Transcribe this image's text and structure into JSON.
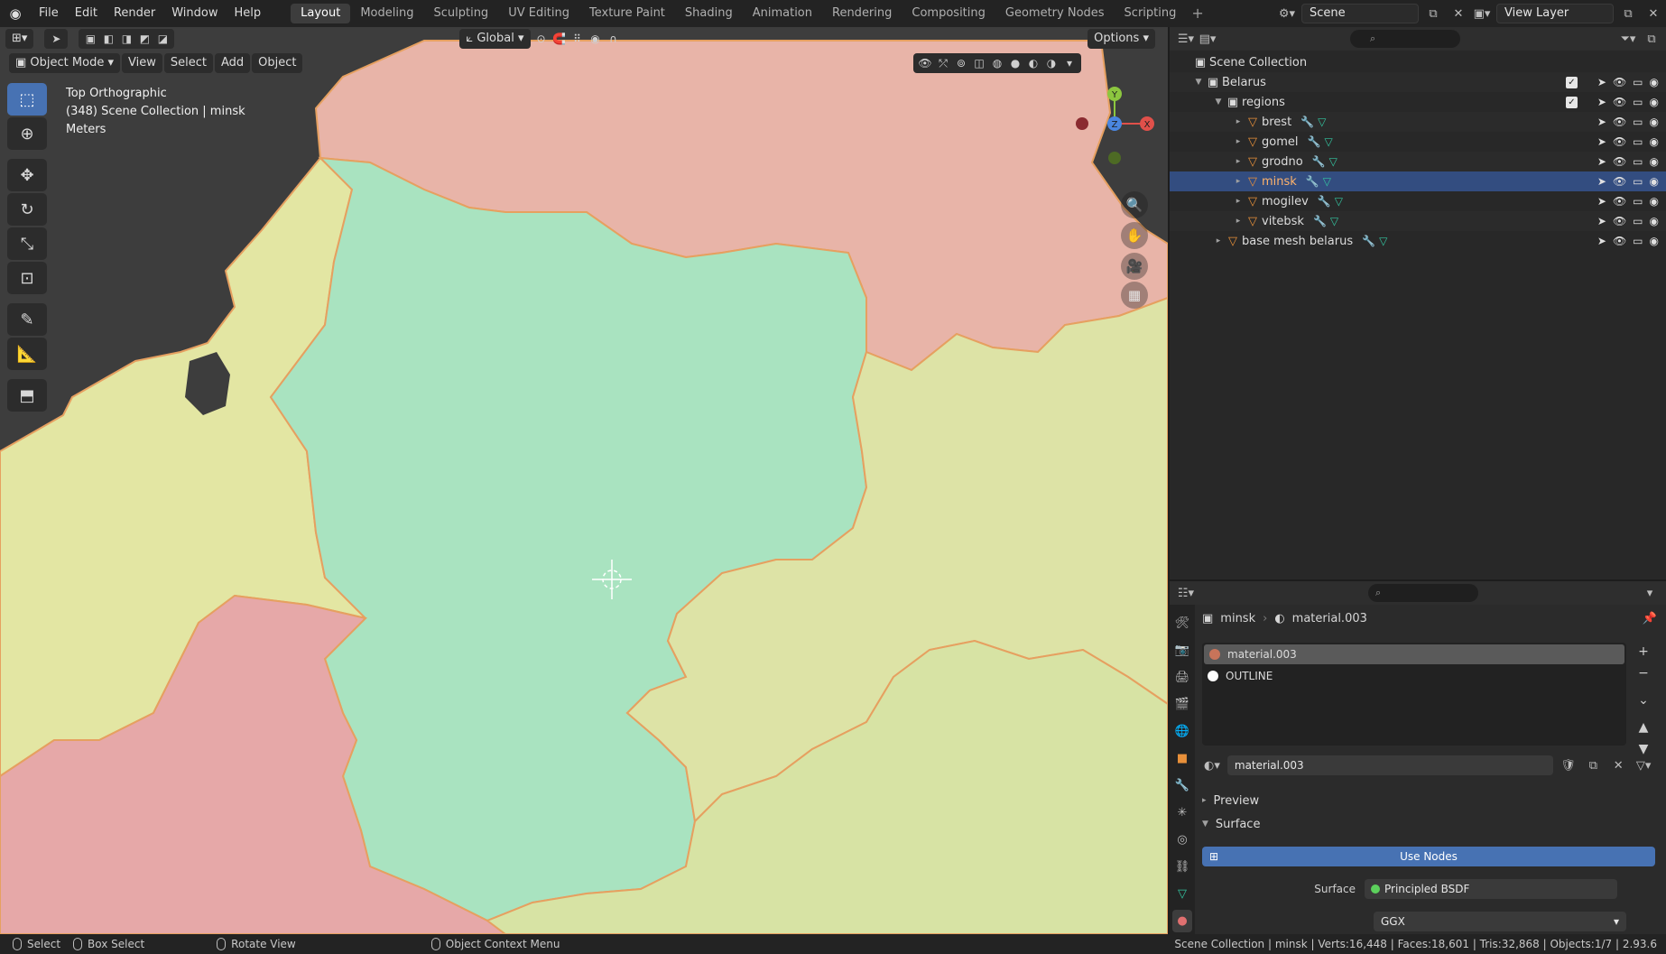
{
  "topbar": {
    "menu": [
      "File",
      "Edit",
      "Render",
      "Window",
      "Help"
    ],
    "workspaces": [
      "Layout",
      "Modeling",
      "Sculpting",
      "UV Editing",
      "Texture Paint",
      "Shading",
      "Animation",
      "Rendering",
      "Compositing",
      "Geometry Nodes",
      "Scripting"
    ],
    "active_workspace": "Layout",
    "scene_name": "Scene",
    "view_layer": "View Layer"
  },
  "viewport": {
    "transform_orientation": "Global",
    "options_label": "Options",
    "mode": "Object Mode",
    "menus": [
      "View",
      "Select",
      "Add",
      "Object"
    ],
    "view_name": "Top Orthographic",
    "collection_info": "(348) Scene Collection | minsk",
    "units": "Meters",
    "gizmo_axes": {
      "y": "Y",
      "z": "Z",
      "x": "X"
    },
    "region_colors": {
      "background": "#3d3d3d",
      "north": "#e8b4a8",
      "west": "#e3e6a3",
      "center": "#a9e3c0",
      "east": "#dde3a6",
      "southwest": "#e6a8a8",
      "southeast": "#d7e3a4",
      "border": "#e6a060"
    }
  },
  "outliner": {
    "search_placeholder": "",
    "root": "Scene Collection",
    "collection": "Belarus",
    "subcollection": "regions",
    "objects": [
      "brest",
      "gomel",
      "grodno",
      "minsk",
      "mogilev",
      "vitebsk"
    ],
    "selected": "minsk",
    "base_object": "base mesh belarus"
  },
  "properties": {
    "object_name": "minsk",
    "material_name": "material.003",
    "slots": [
      {
        "name": "material.003",
        "color": "#c8745a"
      },
      {
        "name": "OUTLINE",
        "color": "#ffffff"
      }
    ],
    "panels": [
      "Preview",
      "Surface"
    ],
    "use_nodes_label": "Use Nodes",
    "surface_label": "Surface",
    "surface_value": "Principled BSDF",
    "distribution": "GGX"
  },
  "status": {
    "select": "Select",
    "box_select": "Box Select",
    "rotate_view": "Rotate View",
    "context_menu": "Object Context Menu",
    "stats": "Scene Collection | minsk | Verts:16,448 | Faces:18,601 | Tris:32,868 | Objects:1/7 | 2.93.6"
  }
}
